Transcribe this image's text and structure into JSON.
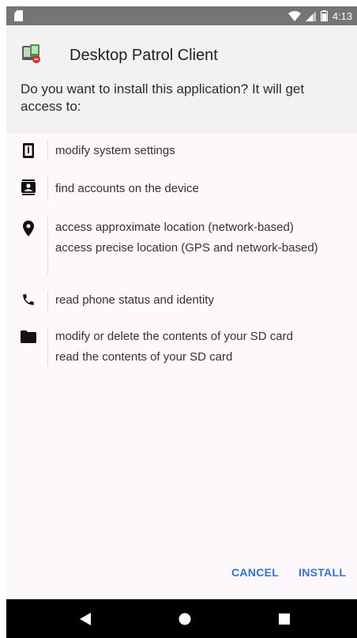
{
  "status_bar": {
    "time": "4:13"
  },
  "app": {
    "name": "Desktop Patrol Client"
  },
  "prompt": "Do you want to install this application? It will get access to:",
  "permissions": [
    {
      "icon": "settings-phone-icon",
      "lines": [
        "modify system settings"
      ]
    },
    {
      "icon": "contacts-icon",
      "lines": [
        "find accounts on the device"
      ]
    },
    {
      "icon": "location-pin-icon",
      "lines": [
        "access approximate location (network-based)",
        "access precise location (GPS and network-based)"
      ]
    },
    {
      "icon": "phone-icon",
      "lines": [
        "read phone status and identity"
      ]
    },
    {
      "icon": "folder-icon",
      "lines": [
        "modify or delete the contents of your SD card",
        "read the contents of your SD card"
      ]
    }
  ],
  "actions": {
    "cancel": "CANCEL",
    "install": "INSTALL"
  },
  "colors": {
    "accent": "#2f73d8",
    "status_bar": "#757575",
    "header_bg": "#f2f2f2",
    "body_bg": "#fcf8fc",
    "nav_bar": "#000000"
  }
}
